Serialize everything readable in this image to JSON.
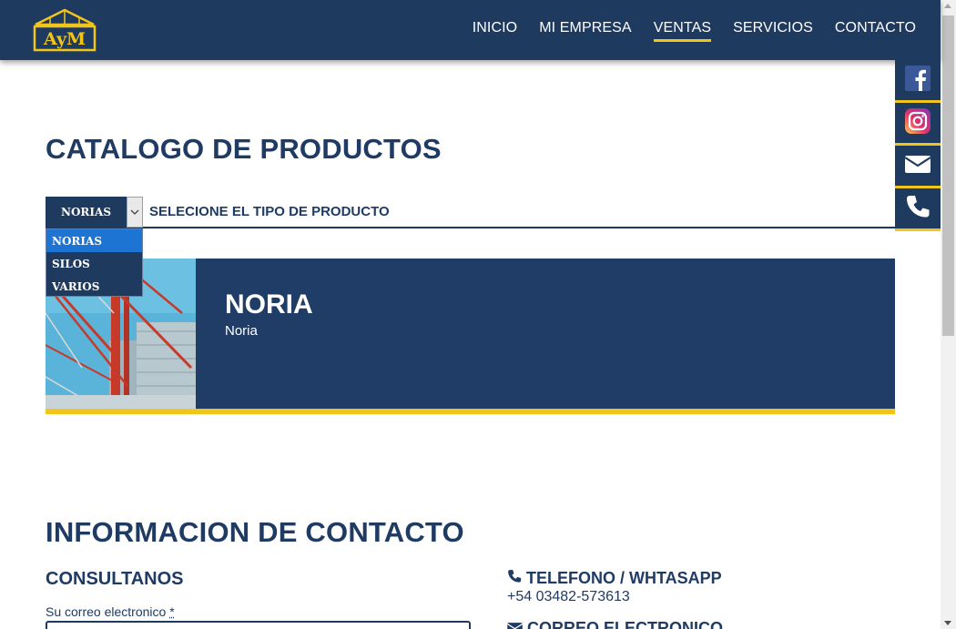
{
  "header": {
    "logo_text": "AyM",
    "nav": [
      {
        "label": "INICIO",
        "active": false
      },
      {
        "label": "MI EMPRESA",
        "active": false
      },
      {
        "label": "VENTAS",
        "active": true
      },
      {
        "label": "SERVICIOS",
        "active": false
      },
      {
        "label": "CONTACTO",
        "active": false
      }
    ]
  },
  "social": [
    {
      "icon": "facebook-icon"
    },
    {
      "icon": "instagram-icon"
    },
    {
      "icon": "envelope-icon"
    },
    {
      "icon": "phone-icon"
    }
  ],
  "catalog": {
    "title": "CATALOGO DE PRODUCTOS",
    "select_value": "NORIAS",
    "select_label": "SELECIONE EL TIPO DE PRODUCTO",
    "options": [
      "NORIAS",
      "SILOS",
      "VARIOS"
    ],
    "selected_option": "NORIAS"
  },
  "product": {
    "title": "NORIA",
    "subtitle": "Noria"
  },
  "contact": {
    "title": "INFORMACION DE CONTACTO",
    "consult_heading": "CONSULTANOS",
    "email_label": "Su correo electronico",
    "required_mark": "*",
    "phone_heading": "TELEFONO / WHTASAPP",
    "phone_value": "+54 03482-573613",
    "mail_heading": "CORREO ELECTRONICO"
  },
  "colors": {
    "navy": "#1f3a5f",
    "accent_yellow": "#f2c51b",
    "dropdown_highlight": "#1e74d3"
  }
}
